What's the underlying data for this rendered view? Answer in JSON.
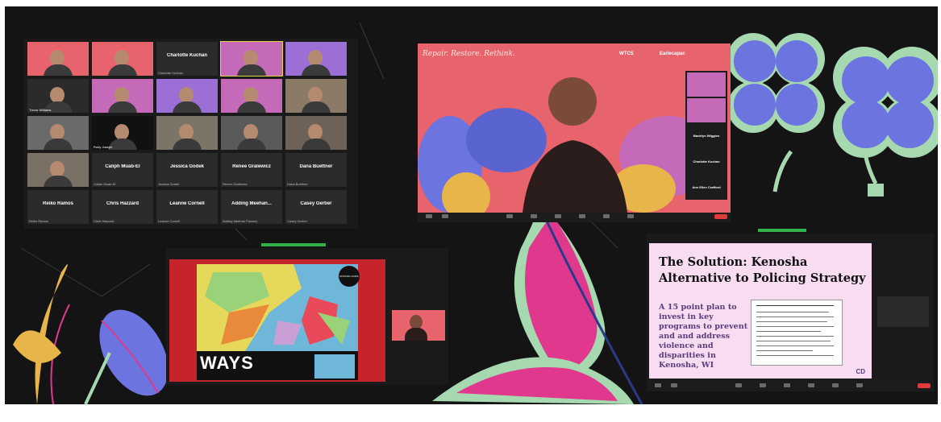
{
  "gallery": {
    "tiles": [
      {
        "name": "",
        "caption": "",
        "type": "video",
        "color": "#e8646c"
      },
      {
        "name": "",
        "caption": "",
        "type": "video",
        "color": "#e8646c"
      },
      {
        "name": "Charlotte Kuchan",
        "caption": "Charlotte Kuchan",
        "type": "name"
      },
      {
        "name": "",
        "caption": "",
        "type": "video",
        "color": "#c46ab8",
        "active": true
      },
      {
        "name": "",
        "caption": "",
        "type": "video",
        "color": "#9b6fd6"
      },
      {
        "name": "",
        "caption": "Trevor Williams",
        "type": "video",
        "color": "#2b2b2b"
      },
      {
        "name": "",
        "caption": "",
        "type": "video",
        "color": "#c46ab8"
      },
      {
        "name": "",
        "caption": "",
        "type": "video",
        "color": "#9b6fd6"
      },
      {
        "name": "",
        "caption": "",
        "type": "video",
        "color": "#c46ab8"
      },
      {
        "name": "",
        "caption": "",
        "type": "video",
        "color": "#8a7a66"
      },
      {
        "name": "",
        "caption": "",
        "type": "video",
        "color": "#6a6a6a"
      },
      {
        "name": "",
        "caption": "Rudy Joseph",
        "type": "video",
        "color": "#111111"
      },
      {
        "name": "",
        "caption": "",
        "type": "video",
        "color": "#7a7566"
      },
      {
        "name": "",
        "caption": "",
        "type": "video",
        "color": "#5a5a5a"
      },
      {
        "name": "",
        "caption": "",
        "type": "video",
        "color": "#6e6258"
      },
      {
        "name": "",
        "caption": "",
        "type": "video",
        "color": "#7a7066"
      },
      {
        "name": "Caliph Muab-El",
        "caption": "Caliph Muab-El",
        "type": "name"
      },
      {
        "name": "Jessica Godek",
        "caption": "Jessica Godek",
        "type": "name"
      },
      {
        "name": "Renee Gralewicz",
        "caption": "Renee Gralewicz",
        "type": "name"
      },
      {
        "name": "Dana Buettner",
        "caption": "Dana Buettner",
        "type": "name"
      },
      {
        "name": "Reiko Ramos",
        "caption": "Reiko Ramos",
        "type": "name"
      },
      {
        "name": "Chris Hazzard",
        "caption": "Chris Hazzard",
        "type": "name"
      },
      {
        "name": "Leanne Cornell",
        "caption": "Leanne Cornell",
        "type": "name"
      },
      {
        "name": "Adding Meehan...",
        "caption": "Adding Meehan Flanney",
        "type": "name"
      },
      {
        "name": "Casey Gerber",
        "caption": "Casey Gerber",
        "type": "name"
      }
    ]
  },
  "presenter": {
    "banner": "Repair. Restore. Rethink.",
    "logo_left": "WTCS",
    "logo_right": "Earlecapac",
    "side_names": [
      "Madelyn Wiggins",
      "Charlotte Kuchan",
      "Ann Ellen Crafford"
    ]
  },
  "map_slide": {
    "title": "WAYS",
    "label_right": "ROSTER LANDS"
  },
  "kenosha_slide": {
    "title": "The Solution: Kenosha Alternative to Policing Strategy",
    "body": "A 15 point plan to invest in key programs to prevent and and address violence and disparities in Kenosha, WI",
    "logo": "CD"
  },
  "colors": {
    "background": "#141414",
    "presenter_bg": "#e8646c",
    "map_bg": "#c4242a",
    "slide_bg": "#f7dcf2",
    "flower_blue": "#6c74e0",
    "leaf_pink": "#e0388c",
    "leaf_mint": "#a6d9b0",
    "leaf_gold": "#e8b54a",
    "end_red": "#e0393e",
    "share_green": "#2fb34a"
  }
}
